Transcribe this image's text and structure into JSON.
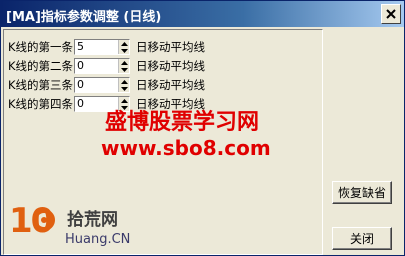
{
  "window": {
    "title": "[MA]指标参数调整 (日线)"
  },
  "params": [
    {
      "label": "K线的第一条",
      "value": "5",
      "unit": "日移动平均线"
    },
    {
      "label": "K线的第二条",
      "value": "0",
      "unit": "日移动平均线"
    },
    {
      "label": "K线的第三条",
      "value": "0",
      "unit": "日移动平均线"
    },
    {
      "label": "K线的第四条",
      "value": "0",
      "unit": "日移动平均线"
    }
  ],
  "buttons": {
    "restore_default": "恢复缺省",
    "close": "关闭"
  },
  "watermark": {
    "cn": "盛博股票学习网",
    "url": "www.sbo8.com"
  },
  "logo": {
    "num": "10",
    "cn": "拾荒网",
    "en": "Huang.CN"
  }
}
